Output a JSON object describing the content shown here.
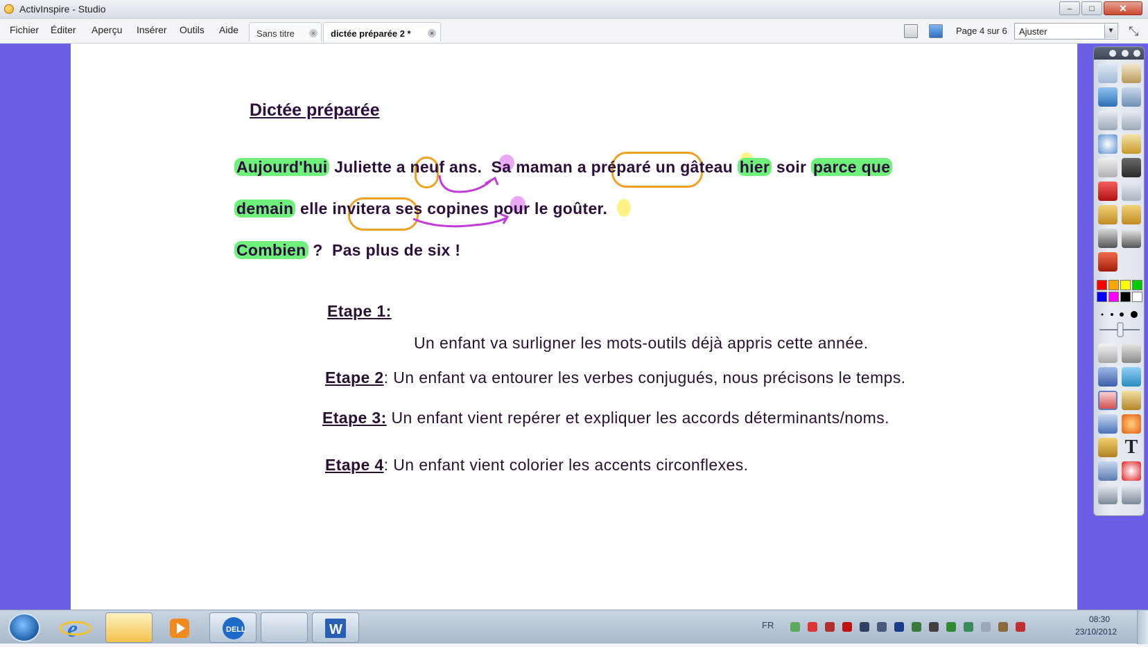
{
  "window": {
    "title": "ActivInspire - Studio",
    "controls": {
      "minimize": "–",
      "maximize": "□",
      "close": "✕"
    }
  },
  "menu": [
    "Fichier",
    "Éditer",
    "Aperçu",
    "Insérer",
    "Outils",
    "Aide"
  ],
  "tabs": [
    {
      "label": "Sans titre",
      "close": "×"
    },
    {
      "label": "dictée préparée 2 *",
      "close": "×",
      "active": true
    }
  ],
  "toolbar": {
    "page_label": "Page 4 sur 6",
    "zoom_value": "Ajuster",
    "expand_icon": "⤡"
  },
  "document": {
    "title": "Dictée préparée",
    "sentence_lines": [
      [
        "Aujourd'hui",
        "Juliette",
        "a",
        "neuf",
        "ans.",
        "Sa",
        "maman",
        "a préparé",
        "un",
        "gâteau",
        "hier",
        "soir",
        "parce que"
      ],
      [
        "demain",
        "elle",
        "invitera",
        "ses",
        "copines",
        "pour",
        "le",
        "goûter."
      ],
      [
        "Combien",
        "?",
        "Pas plus de six !"
      ]
    ],
    "steps": [
      {
        "heading": "Etape 1:",
        "text": "Un enfant va surligner les mots-outils déjà appris cette année."
      },
      {
        "heading": "Etape 2",
        "text": ": Un enfant va entourer les verbes conjugués, nous précisons le temps."
      },
      {
        "heading": "Etape 3:",
        "text": " Un enfant vient repérer et expliquer les accords déterminants/noms."
      },
      {
        "heading": "Etape 4",
        "text": ": Un enfant vient colorier les accents circonflexes."
      }
    ],
    "colors": {
      "highlight": "#6ff07a",
      "verb_circle": "#f0a020",
      "agreement_mark": "#c03bd8",
      "accent_mark": "#fff27a",
      "page_background": "#6a5fe6"
    }
  },
  "toolbox": {
    "colors": [
      "#ff0000",
      "#ffa500",
      "#ffff00",
      "#00cc00",
      "#0000ff",
      "#ff00ff",
      "#000000",
      "#ffffff"
    ],
    "text_tool_glyph": "T"
  },
  "taskbar": {
    "language": "FR",
    "time": "08:30",
    "date": "23/10/2012"
  }
}
